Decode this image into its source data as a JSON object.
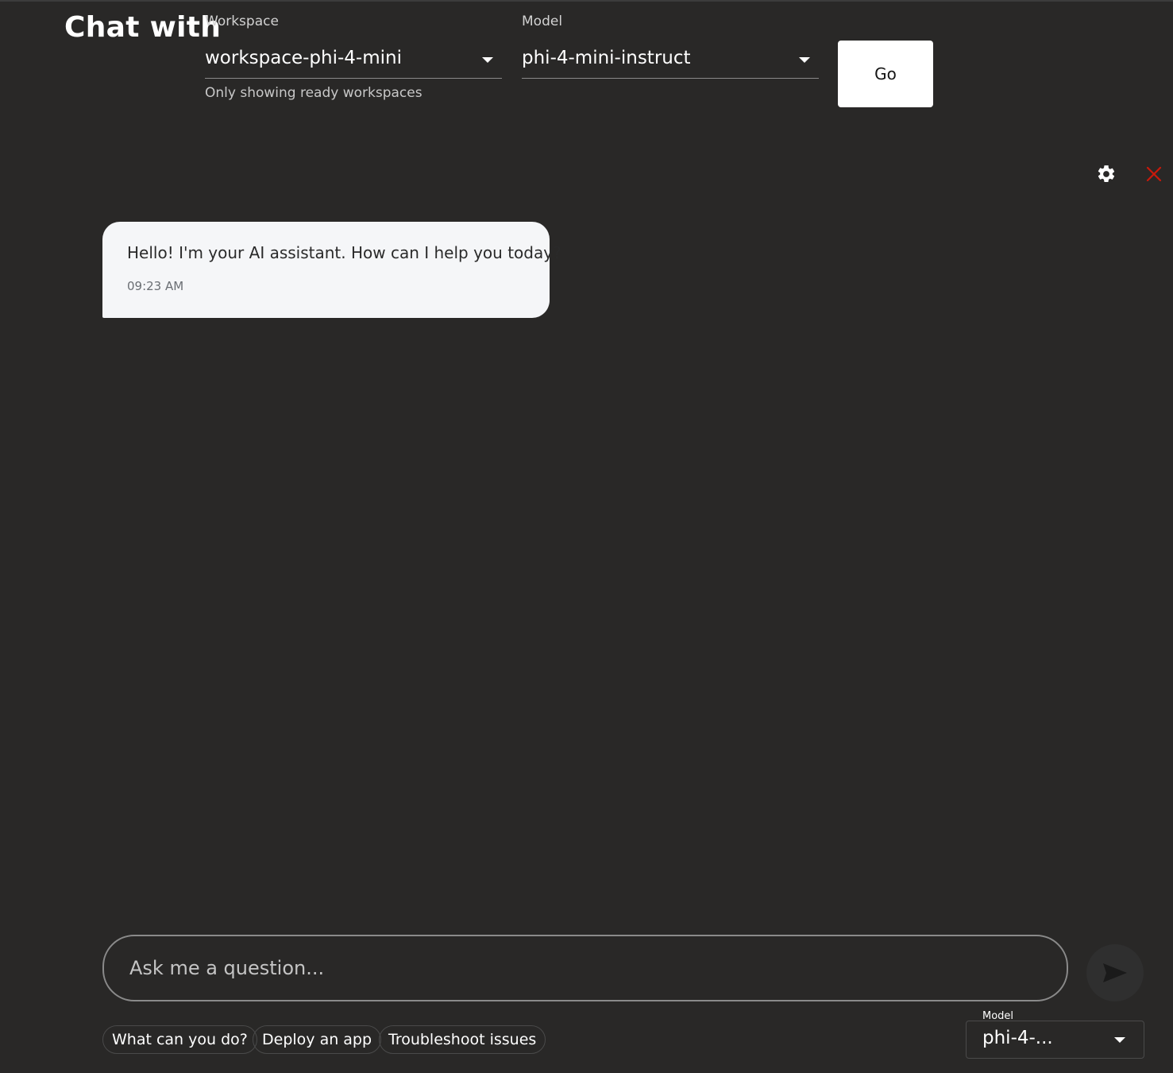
{
  "header": {
    "title": "Chat with",
    "workspace": {
      "label": "Workspace",
      "value": "workspace-phi-4-mini",
      "helper": "Only showing ready workspaces"
    },
    "model": {
      "label": "Model",
      "value": "phi-4-mini-instruct"
    },
    "go_label": "Go"
  },
  "toolbar": {
    "settings_icon": "gear-icon",
    "close_icon": "close-icon",
    "close_color": "#c9190b"
  },
  "messages": [
    {
      "role": "assistant",
      "text": "Hello! I'm your AI assistant. How can I help you today?",
      "time": "09:23 AM"
    }
  ],
  "composer": {
    "placeholder": "Ask me a question...",
    "send_icon": "send-icon",
    "suggestions": [
      "What can you do?",
      "Deploy an app",
      "Troubleshoot issues"
    ],
    "model_label": "Model",
    "model_value": "phi-4-..."
  }
}
